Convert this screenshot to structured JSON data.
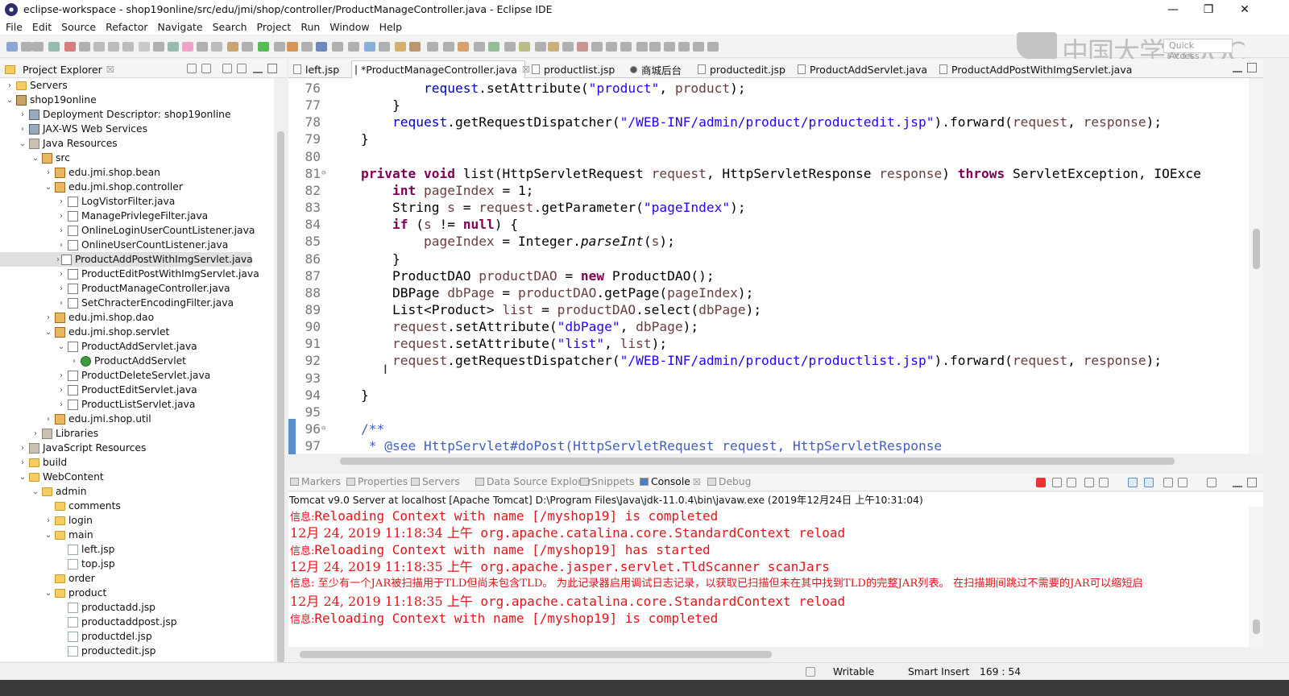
{
  "window": {
    "title": "eclipse-workspace - shop19online/src/edu/jmi/shop/controller/ProductManageController.java - Eclipse IDE",
    "min_glyph": "—",
    "max_glyph": "❐",
    "close_glyph": "✕"
  },
  "menu": [
    "File",
    "Edit",
    "Source",
    "Refactor",
    "Navigate",
    "Search",
    "Project",
    "Run",
    "Window",
    "Help"
  ],
  "watermark": "中国大学MOOC",
  "quick_access": "Quick Access",
  "project_explorer": {
    "title": "Project Explorer",
    "close": "☒",
    "rows": [
      {
        "label": "Servers",
        "twisty": "›",
        "icon": "folder",
        "indent": 0
      },
      {
        "label": "shop19online",
        "twisty": "⌄",
        "icon": "proj",
        "indent": 0
      },
      {
        "label": "Deployment Descriptor: shop19online",
        "twisty": "›",
        "icon": "srv",
        "indent": 1
      },
      {
        "label": "JAX-WS Web Services",
        "twisty": "›",
        "icon": "srv",
        "indent": 1
      },
      {
        "label": "Java Resources",
        "twisty": "⌄",
        "icon": "lib",
        "indent": 1
      },
      {
        "label": "src",
        "twisty": "⌄",
        "icon": "pkg",
        "indent": 2
      },
      {
        "label": "edu.jmi.shop.bean",
        "twisty": "›",
        "icon": "pkg",
        "indent": 3
      },
      {
        "label": "edu.jmi.shop.controller",
        "twisty": "⌄",
        "icon": "pkg",
        "indent": 3
      },
      {
        "label": "LogVistorFilter.java",
        "twisty": "›",
        "icon": "java",
        "indent": 4
      },
      {
        "label": "ManagePrivlegeFilter.java",
        "twisty": "›",
        "icon": "java",
        "indent": 4
      },
      {
        "label": "OnlineLoginUserCountListener.java",
        "twisty": "›",
        "icon": "java",
        "indent": 4
      },
      {
        "label": "OnlineUserCountListener.java",
        "twisty": "›",
        "icon": "java",
        "indent": 4
      },
      {
        "label": "ProductAddPostWithImgServlet.java",
        "twisty": "›",
        "icon": "java",
        "indent": 4,
        "selected": true
      },
      {
        "label": "ProductEditPostWithImgServlet.java",
        "twisty": "›",
        "icon": "java",
        "indent": 4
      },
      {
        "label": "ProductManageController.java",
        "twisty": "›",
        "icon": "java",
        "indent": 4
      },
      {
        "label": "SetChracterEncodingFilter.java",
        "twisty": "›",
        "icon": "java",
        "indent": 4
      },
      {
        "label": "edu.jmi.shop.dao",
        "twisty": "›",
        "icon": "pkg",
        "indent": 3
      },
      {
        "label": "edu.jmi.shop.servlet",
        "twisty": "⌄",
        "icon": "pkg",
        "indent": 3
      },
      {
        "label": "ProductAddServlet.java",
        "twisty": "⌄",
        "icon": "java",
        "indent": 4
      },
      {
        "label": "ProductAddServlet",
        "twisty": "›",
        "icon": "class",
        "indent": 5
      },
      {
        "label": "ProductDeleteServlet.java",
        "twisty": "›",
        "icon": "java",
        "indent": 4
      },
      {
        "label": "ProductEditServlet.java",
        "twisty": "›",
        "icon": "java",
        "indent": 4
      },
      {
        "label": "ProductListServlet.java",
        "twisty": "›",
        "icon": "java",
        "indent": 4
      },
      {
        "label": "edu.jmi.shop.util",
        "twisty": "›",
        "icon": "pkg",
        "indent": 3
      },
      {
        "label": "Libraries",
        "twisty": "›",
        "icon": "lib",
        "indent": 2
      },
      {
        "label": "JavaScript Resources",
        "twisty": "›",
        "icon": "lib",
        "indent": 1
      },
      {
        "label": "build",
        "twisty": "›",
        "icon": "folder",
        "indent": 1
      },
      {
        "label": "WebContent",
        "twisty": "⌄",
        "icon": "folder",
        "indent": 1
      },
      {
        "label": "admin",
        "twisty": "⌄",
        "icon": "folder",
        "indent": 2
      },
      {
        "label": "comments",
        "twisty": "",
        "icon": "folder",
        "indent": 3
      },
      {
        "label": "login",
        "twisty": "›",
        "icon": "folder",
        "indent": 3
      },
      {
        "label": "main",
        "twisty": "⌄",
        "icon": "folder",
        "indent": 3
      },
      {
        "label": "left.jsp",
        "twisty": "",
        "icon": "jsp",
        "indent": 4
      },
      {
        "label": "top.jsp",
        "twisty": "",
        "icon": "jsp",
        "indent": 4
      },
      {
        "label": "order",
        "twisty": "",
        "icon": "folder",
        "indent": 3
      },
      {
        "label": "product",
        "twisty": "⌄",
        "icon": "folder",
        "indent": 3
      },
      {
        "label": "productadd.jsp",
        "twisty": "",
        "icon": "jsp",
        "indent": 4
      },
      {
        "label": "productaddpost.jsp",
        "twisty": "",
        "icon": "jsp",
        "indent": 4
      },
      {
        "label": "productdel.jsp",
        "twisty": "",
        "icon": "jsp",
        "indent": 4
      },
      {
        "label": "productedit.jsp",
        "twisty": "",
        "icon": "jsp",
        "indent": 4
      }
    ]
  },
  "editor_tabs": [
    {
      "label": "left.jsp",
      "active": false
    },
    {
      "label": "*ProductManageController.java",
      "active": true,
      "close": "☒"
    },
    {
      "label": "productlist.jsp",
      "active": false
    },
    {
      "label": "商城后台",
      "active": false
    },
    {
      "label": "productedit.jsp",
      "active": false
    },
    {
      "label": "ProductAddServlet.java",
      "active": false
    },
    {
      "label": "ProductAddPostWithImgServlet.java",
      "active": false
    }
  ],
  "code": [
    {
      "n": "76",
      "t": [
        [
          "",
          "        "
        ],
        [
          "fd",
          "request"
        ],
        [
          "",
          ".setAttribute("
        ],
        [
          "st",
          "\"product\""
        ],
        [
          "",
          ", "
        ],
        [
          "lv",
          "product"
        ],
        [
          "",
          ");"
        ]
      ]
    },
    {
      "n": "77",
      "t": [
        [
          "",
          "    }"
        ]
      ]
    },
    {
      "n": "78",
      "t": [
        [
          "",
          "    "
        ],
        [
          "fd",
          "request"
        ],
        [
          "",
          ".getRequestDispatcher("
        ],
        [
          "st",
          "\"/WEB-INF/admin/product/productedit.jsp\""
        ],
        [
          "",
          ").forward("
        ],
        [
          "lv",
          "request"
        ],
        [
          "",
          ", "
        ],
        [
          "lv",
          "response"
        ],
        [
          "",
          ");"
        ]
      ]
    },
    {
      "n": "79",
      "t": [
        [
          "",
          "}"
        ]
      ]
    },
    {
      "n": "80",
      "t": []
    },
    {
      "n": "81",
      "t": [
        [
          "kw",
          "private"
        ],
        [
          "",
          " "
        ],
        [
          "kw",
          "void"
        ],
        [
          "",
          " list(HttpServletRequest "
        ],
        [
          "lv",
          "request"
        ],
        [
          "",
          ", HttpServletResponse "
        ],
        [
          "lv",
          "response"
        ],
        [
          "",
          ") "
        ],
        [
          "kw",
          "throws"
        ],
        [
          "",
          " ServletException, IOExce"
        ]
      ]
    },
    {
      "n": "82",
      "t": [
        [
          "",
          "    "
        ],
        [
          "kw",
          "int"
        ],
        [
          "",
          " "
        ],
        [
          "lv",
          "pageIndex"
        ],
        [
          "",
          " = 1;"
        ]
      ]
    },
    {
      "n": "83",
      "t": [
        [
          "",
          "    String "
        ],
        [
          "lv",
          "s"
        ],
        [
          "",
          " = "
        ],
        [
          "lv",
          "request"
        ],
        [
          "",
          ".getParameter("
        ],
        [
          "st",
          "\"pageIndex\""
        ],
        [
          "",
          ");"
        ]
      ]
    },
    {
      "n": "84",
      "t": [
        [
          "",
          "    "
        ],
        [
          "kw",
          "if"
        ],
        [
          "",
          " ("
        ],
        [
          "lv",
          "s"
        ],
        [
          "",
          " != "
        ],
        [
          "kw",
          "null"
        ],
        [
          "",
          ") {"
        ]
      ]
    },
    {
      "n": "85",
      "t": [
        [
          "",
          "        "
        ],
        [
          "lv",
          "pageIndex"
        ],
        [
          "",
          " = Integer."
        ],
        [
          "it",
          "parseInt"
        ],
        [
          "",
          "("
        ],
        [
          "lv",
          "s"
        ],
        [
          "",
          ");"
        ]
      ]
    },
    {
      "n": "86",
      "t": [
        [
          "",
          "    }"
        ]
      ]
    },
    {
      "n": "87",
      "t": [
        [
          "",
          "    ProductDAO "
        ],
        [
          "lv",
          "productDAO"
        ],
        [
          "",
          " = "
        ],
        [
          "kw",
          "new"
        ],
        [
          "",
          " ProductDAO();"
        ]
      ]
    },
    {
      "n": "88",
      "t": [
        [
          "",
          "    DBPage "
        ],
        [
          "lv",
          "dbPage"
        ],
        [
          "",
          " = "
        ],
        [
          "lv",
          "productDAO"
        ],
        [
          "",
          ".getPage("
        ],
        [
          "lv",
          "pageIndex"
        ],
        [
          "",
          ");"
        ]
      ]
    },
    {
      "n": "89",
      "t": [
        [
          "",
          "    List<Product> "
        ],
        [
          "lv",
          "list"
        ],
        [
          "",
          " = "
        ],
        [
          "lv",
          "productDAO"
        ],
        [
          "",
          ".select("
        ],
        [
          "lv",
          "dbPage"
        ],
        [
          "",
          ");"
        ]
      ]
    },
    {
      "n": "90",
      "t": [
        [
          "",
          "    "
        ],
        [
          "lv",
          "request"
        ],
        [
          "",
          ".setAttribute("
        ],
        [
          "st",
          "\"dbPage\""
        ],
        [
          "",
          ", "
        ],
        [
          "lv",
          "dbPage"
        ],
        [
          "",
          ");"
        ]
      ]
    },
    {
      "n": "91",
      "t": [
        [
          "",
          "    "
        ],
        [
          "lv",
          "request"
        ],
        [
          "",
          ".setAttribute("
        ],
        [
          "st",
          "\"list\""
        ],
        [
          "",
          ", "
        ],
        [
          "lv",
          "list"
        ],
        [
          "",
          ");"
        ]
      ]
    },
    {
      "n": "92",
      "t": [
        [
          "",
          "    "
        ],
        [
          "lv",
          "request"
        ],
        [
          "",
          ".getRequestDispatcher("
        ],
        [
          "st",
          "\"/WEB-INF/admin/product/productlist.jsp\""
        ],
        [
          "",
          ").forward("
        ],
        [
          "lv",
          "request"
        ],
        [
          "",
          ", "
        ],
        [
          "lv",
          "response"
        ],
        [
          "",
          ");"
        ]
      ]
    },
    {
      "n": "93",
      "t": []
    },
    {
      "n": "94",
      "t": [
        [
          "",
          "}"
        ]
      ]
    },
    {
      "n": "95",
      "t": []
    },
    {
      "n": "96",
      "t": [
        [
          "cm",
          "/**"
        ]
      ]
    },
    {
      "n": "97",
      "t": [
        [
          "cm",
          " * @see HttpServlet#doPost(HttpServletRequest request, HttpServletResponse"
        ]
      ]
    }
  ],
  "bottom_tabs": [
    {
      "label": "Markers",
      "active": false
    },
    {
      "label": "Properties",
      "active": false
    },
    {
      "label": "Servers",
      "active": false
    },
    {
      "label": "Data Source Explorer",
      "active": false
    },
    {
      "label": "Snippets",
      "active": false
    },
    {
      "label": "Console",
      "active": true,
      "close": "☒"
    },
    {
      "label": "Debug",
      "active": false
    }
  ],
  "console_header": "Tomcat v9.0 Server at localhost [Apache Tomcat] D:\\Program Files\\Java\\jdk-11.0.4\\bin\\javaw.exe (2019年12月24日 上午10:31:04)",
  "console_lines": [
    {
      "zh": "信息:",
      "text": "Reloading Context with name [/myshop19] is completed",
      "small": false
    },
    {
      "zh": "12月 24, 2019 11:18:34 上午",
      "text": " org.apache.catalina.core.StandardContext reload",
      "small": false
    },
    {
      "zh": "信息:",
      "text": "Reloading Context with name [/myshop19] has started",
      "small": false
    },
    {
      "zh": "12月 24, 2019 11:18:35 上午",
      "text": " org.apache.jasper.servlet.TldScanner scanJars",
      "small": false
    },
    {
      "zh": "信息:",
      "text": " 至少有一个JAR被扫描用于TLD但尚未包含TLD。 为此记录器启用调试日志记录，以获取已扫描但未在其中找到TLD的完整JAR列表。 在扫描期间跳过不需要的JAR可以缩短启",
      "small": true
    },
    {
      "zh": "12月 24, 2019 11:18:35 上午",
      "text": " org.apache.catalina.core.StandardContext reload",
      "small": false
    },
    {
      "zh": "信息:",
      "text": "Reloading Context with name [/myshop19] is completed",
      "small": false
    }
  ],
  "status": {
    "writable": "Writable",
    "insert_mode": "Smart Insert",
    "position": "169 : 54"
  },
  "colors": {
    "console_text": "#e3141a",
    "keyword": "#7f0055",
    "string": "#2a00ff",
    "local": "#6a3e3e",
    "comment": "#3f5fbf"
  }
}
